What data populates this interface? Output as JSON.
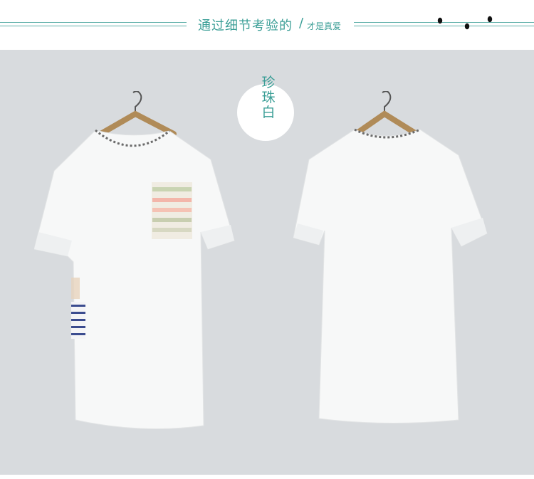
{
  "header": {
    "title_main": "通过细节考验的",
    "slash": "/",
    "title_sub": "才是真爱",
    "accent_color": "#3a9e96"
  },
  "photo": {
    "color_name": "珍珠白",
    "background_color": "#d8dbde",
    "items": [
      {
        "name": "front-view-dress",
        "icon": "tshirt-dress-front"
      },
      {
        "name": "back-view-dress",
        "icon": "tshirt-dress-back"
      }
    ]
  }
}
